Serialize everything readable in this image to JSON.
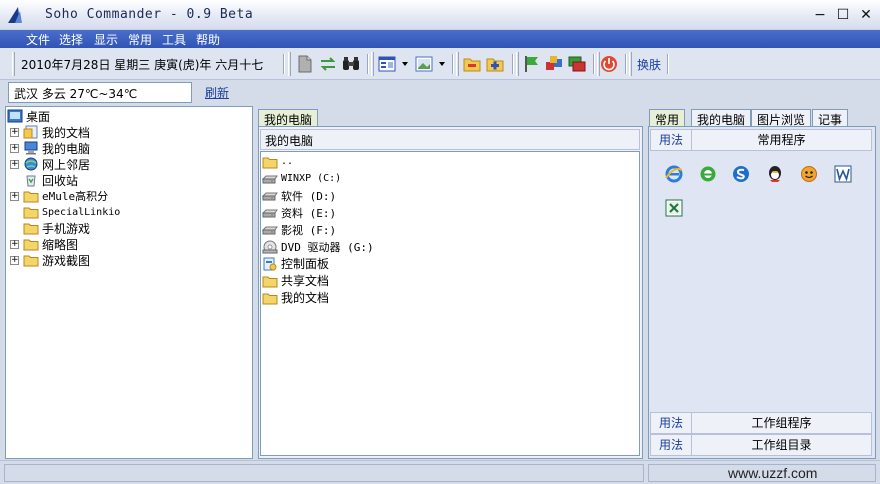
{
  "window": {
    "title": "Soho Commander - 0.9 Beta",
    "controls": {
      "minimize": "−",
      "maximize": "☐",
      "close": "✕"
    }
  },
  "menu": {
    "items": [
      "文件",
      "选择",
      "显示",
      "常用",
      "工具",
      "帮助"
    ]
  },
  "toolbar": {
    "date_text": "2010年7月28日  星期三  庚寅(虎)年 六月十七",
    "skin_label": "换肤",
    "icons": [
      "document-icon",
      "swap-icon",
      "binoculars-icon",
      "view-icon",
      "thumbnail-view-icon",
      "folder-minus-icon",
      "folder-plus-icon",
      "green-flag-icon",
      "boxes-icon",
      "window-stack-icon",
      "power-icon"
    ]
  },
  "weather": {
    "text": "武汉  多云  27℃~34℃",
    "refresh_label": "刷新"
  },
  "tree": {
    "root": "桌面",
    "items": [
      {
        "label": "我的文档",
        "expander": "+",
        "icon": "documents-icon"
      },
      {
        "label": "我的电脑",
        "expander": "+",
        "icon": "computer-icon"
      },
      {
        "label": "网上邻居",
        "expander": "+",
        "icon": "network-icon"
      },
      {
        "label": "回收站",
        "expander": "",
        "icon": "recycle-bin-icon"
      },
      {
        "label": "eMule高积分",
        "expander": "+",
        "icon": "folder-icon"
      },
      {
        "label": "SpecialLinkio",
        "expander": "",
        "icon": "folder-icon"
      },
      {
        "label": "手机游戏",
        "expander": "",
        "icon": "folder-icon"
      },
      {
        "label": "缩略图",
        "expander": "+",
        "icon": "folder-icon"
      },
      {
        "label": "游戏截图",
        "expander": "+",
        "icon": "folder-icon"
      }
    ]
  },
  "middle": {
    "tab": "我的电脑",
    "header": "我的电脑",
    "items": [
      {
        "label": "..",
        "icon": "folder-up-icon"
      },
      {
        "label": "WINXP (C:)",
        "icon": "drive-icon"
      },
      {
        "label": "软件 (D:)",
        "icon": "drive-icon"
      },
      {
        "label": "资料 (E:)",
        "icon": "drive-icon"
      },
      {
        "label": "影视 (F:)",
        "icon": "drive-icon"
      },
      {
        "label": "DVD 驱动器 (G:)",
        "icon": "dvd-icon"
      },
      {
        "label": "控制面板",
        "icon": "control-panel-icon"
      },
      {
        "label": "共享文档",
        "icon": "folder-icon"
      },
      {
        "label": "我的文档",
        "icon": "folder-icon"
      }
    ]
  },
  "right": {
    "tabs": [
      "常用",
      "我的电脑",
      "图片浏览",
      "记事"
    ],
    "usage_label": "用法",
    "common_programs": "常用程序",
    "workgroup_programs": "工作组程序",
    "workgroup_dirs": "工作组目录",
    "apps": [
      "ie-icon",
      "ie-green-icon",
      "sogou-icon",
      "qq-icon",
      "face-icon",
      "word-icon",
      "excel-icon"
    ]
  },
  "status": {
    "watermark": "www.uzzf.com"
  }
}
